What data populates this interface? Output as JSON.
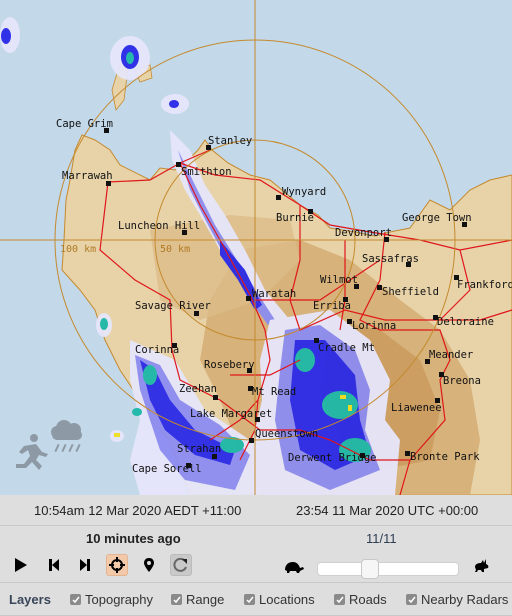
{
  "map": {
    "colors": {
      "sea": "#c3d8e8",
      "land": "#e8d3a9",
      "range_ring": "#c48a2e",
      "road": "#e0161b"
    },
    "range_rings": [
      {
        "label": "100 km"
      },
      {
        "label": "50 km"
      }
    ],
    "towns": [
      {
        "name": "Cape Grim"
      },
      {
        "name": "Stanley"
      },
      {
        "name": "Smithton"
      },
      {
        "name": "Marrawah"
      },
      {
        "name": "Wynyard"
      },
      {
        "name": "Burnie"
      },
      {
        "name": "George Town"
      },
      {
        "name": "Luncheon Hill"
      },
      {
        "name": "Devonport"
      },
      {
        "name": "Sassafras"
      },
      {
        "name": "Wilmot"
      },
      {
        "name": "Sheffield"
      },
      {
        "name": "Frankford"
      },
      {
        "name": "Waratah"
      },
      {
        "name": "Erriba"
      },
      {
        "name": "Savage River"
      },
      {
        "name": "Lorinna"
      },
      {
        "name": "Deloraine"
      },
      {
        "name": "Cradle Mt"
      },
      {
        "name": "Corinna"
      },
      {
        "name": "Meander"
      },
      {
        "name": "Rosebery"
      },
      {
        "name": "Breona"
      },
      {
        "name": "Zeehan"
      },
      {
        "name": "Mt Read"
      },
      {
        "name": "Lake Margaret"
      },
      {
        "name": "Liawenee"
      },
      {
        "name": "Queenstown"
      },
      {
        "name": "Strahan"
      },
      {
        "name": "Derwent Bridge"
      },
      {
        "name": "Bronte Park"
      },
      {
        "name": "Cape Sorell"
      }
    ],
    "weather_icon": "running-in-rain-icon"
  },
  "panel": {
    "local_time": "10:54am 12 Mar 2020 AEDT +11:00",
    "utc_time": "23:54 11 Mar 2020 UTC +00:00",
    "age": "10 minutes ago",
    "frame": "11/11",
    "controls": {
      "play": "play-icon",
      "prev": "step-back-icon",
      "next": "step-forward-icon",
      "center": "crosshair-icon",
      "location": "map-pin-icon",
      "refresh": "refresh-icon"
    },
    "speed": {
      "slow": "turtle-icon",
      "fast": "rabbit-icon",
      "value_fraction": 0.35
    },
    "layers": {
      "title": "Layers",
      "items": [
        {
          "label": "Topography",
          "checked": true
        },
        {
          "label": "Range",
          "checked": true
        },
        {
          "label": "Locations",
          "checked": true
        },
        {
          "label": "Roads",
          "checked": true
        },
        {
          "label": "Nearby Radars",
          "checked": true
        }
      ]
    }
  }
}
